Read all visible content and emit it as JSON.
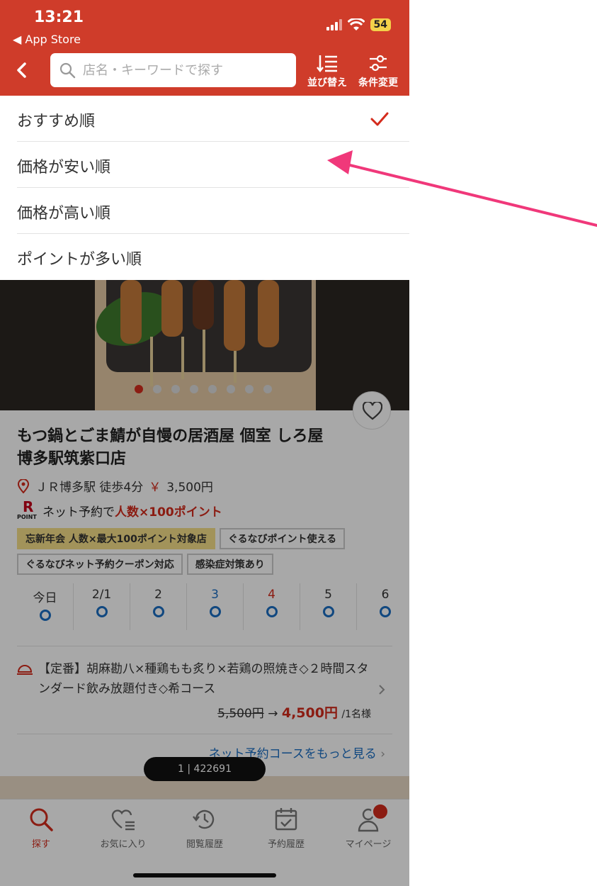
{
  "status_bar": {
    "time": "13:21",
    "back_app": "◀ App Store",
    "battery": "54"
  },
  "header": {
    "search_placeholder": "店名・キーワードで探す",
    "sort_label": "並び替え",
    "filter_label": "条件変更"
  },
  "sort_menu": {
    "items": [
      {
        "label": "おすすめ順",
        "selected": true
      },
      {
        "label": "価格が安い順",
        "selected": false
      },
      {
        "label": "価格が高い順",
        "selected": false
      },
      {
        "label": "ポイントが多い順",
        "selected": false
      }
    ]
  },
  "listing": {
    "name": "もつ鍋とごま鯖が自慢の居酒屋 個室 しろ屋 博多駅筑紫口店",
    "access": "ＪＲ博多駅 徒歩4分",
    "yen": "￥",
    "price": "3,500円",
    "point_text": "ネット予約で",
    "point_highlight": "人数×100ポイント",
    "rpoint_r": "R",
    "rpoint_label": "POINT",
    "tags": [
      "忘新年会 人数×最大100ポイント対象店",
      "ぐるなびポイント使える",
      "ぐるなびネット予約クーポン対応",
      "感染症対策あり"
    ],
    "calendar": [
      {
        "label": "今日",
        "kind": "normal"
      },
      {
        "label": "2/1",
        "kind": "normal"
      },
      {
        "label": "2",
        "kind": "normal"
      },
      {
        "label": "3",
        "kind": "sat"
      },
      {
        "label": "4",
        "kind": "sun"
      },
      {
        "label": "5",
        "kind": "normal"
      },
      {
        "label": "6",
        "kind": "normal"
      }
    ],
    "course_title": "【定番】胡麻勘八×種鶏もも炙り×若鶏の照焼き◇２時間スタンダード飲み放題付き◇希コース",
    "old_price": "5,500円",
    "arrow": "→",
    "new_price": "4,500円",
    "per": "/1名様",
    "more_link": "ネット予約コースをもっと見る",
    "pager": "1 | 422691"
  },
  "tabbar": {
    "tabs": [
      {
        "label": "探す"
      },
      {
        "label": "お気に入り"
      },
      {
        "label": "閲覧履歴"
      },
      {
        "label": "予約履歴"
      },
      {
        "label": "マイページ"
      }
    ]
  },
  "colors": {
    "brand": "#cf3c2a",
    "accent_red": "#d42b1c",
    "link_blue": "#1b6ec2",
    "annotation": "#f0387a"
  }
}
